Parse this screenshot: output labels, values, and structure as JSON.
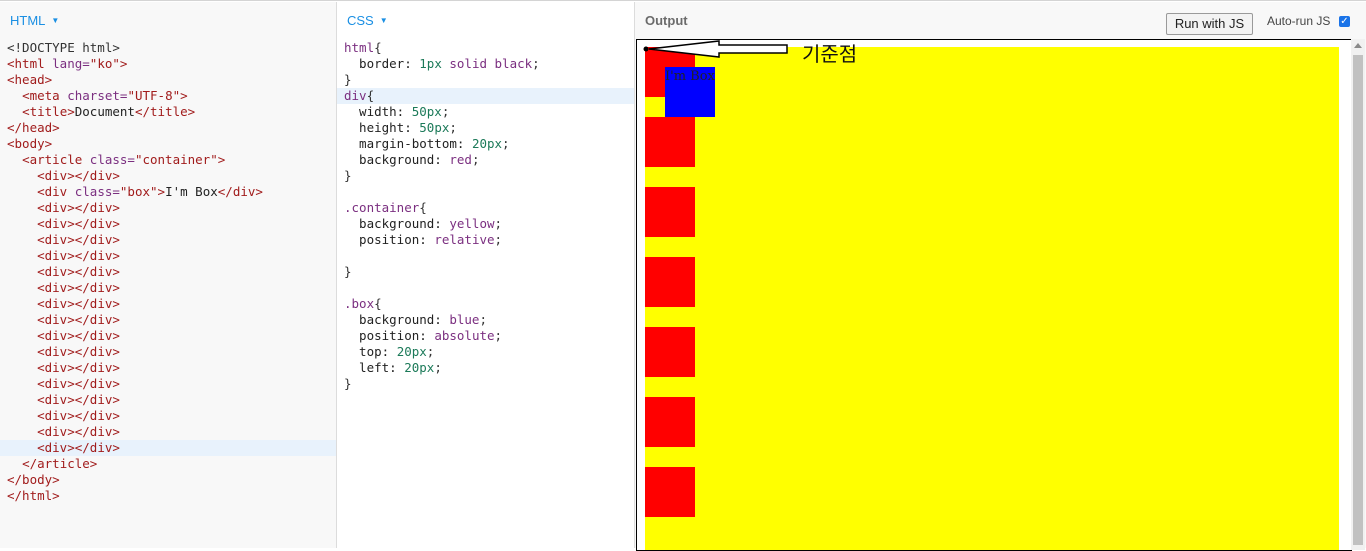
{
  "html_panel": {
    "title": "HTML",
    "lines": [
      [
        [
          "t-punc",
          "<!DOCTYPE html>"
        ]
      ],
      [
        [
          "t-tag",
          "<html "
        ],
        [
          "t-attr",
          "lang="
        ],
        [
          "t-str",
          "\"ko\""
        ],
        [
          "t-tag",
          ">"
        ]
      ],
      [
        [
          "t-tag",
          "<head>"
        ]
      ],
      [
        [
          "t-txt",
          "  "
        ],
        [
          "t-tag",
          "<meta "
        ],
        [
          "t-attr",
          "charset="
        ],
        [
          "t-str",
          "\"UTF-8\""
        ],
        [
          "t-tag",
          ">"
        ]
      ],
      [
        [
          "t-txt",
          "  "
        ],
        [
          "t-tag",
          "<title>"
        ],
        [
          "t-txt",
          "Document"
        ],
        [
          "t-tag",
          "</title>"
        ]
      ],
      [
        [
          "t-tag",
          "</head>"
        ]
      ],
      [
        [
          "t-tag",
          "<body>"
        ]
      ],
      [
        [
          "t-txt",
          "  "
        ],
        [
          "t-tag",
          "<article "
        ],
        [
          "t-attr",
          "class="
        ],
        [
          "t-str",
          "\"container\""
        ],
        [
          "t-tag",
          ">"
        ]
      ],
      [
        [
          "t-txt",
          "    "
        ],
        [
          "t-tag",
          "<div></div>"
        ]
      ],
      [
        [
          "t-txt",
          "    "
        ],
        [
          "t-tag",
          "<div "
        ],
        [
          "t-attr",
          "class="
        ],
        [
          "t-str",
          "\"box\""
        ],
        [
          "t-tag",
          ">"
        ],
        [
          "t-txt",
          "I'm Box"
        ],
        [
          "t-tag",
          "</div>"
        ]
      ],
      [
        [
          "t-txt",
          "    "
        ],
        [
          "t-tag",
          "<div></div>"
        ]
      ],
      [
        [
          "t-txt",
          "    "
        ],
        [
          "t-tag",
          "<div></div>"
        ]
      ],
      [
        [
          "t-txt",
          "    "
        ],
        [
          "t-tag",
          "<div></div>"
        ]
      ],
      [
        [
          "t-txt",
          "    "
        ],
        [
          "t-tag",
          "<div></div>"
        ]
      ],
      [
        [
          "t-txt",
          "    "
        ],
        [
          "t-tag",
          "<div></div>"
        ]
      ],
      [
        [
          "t-txt",
          "    "
        ],
        [
          "t-tag",
          "<div></div>"
        ]
      ],
      [
        [
          "t-txt",
          "    "
        ],
        [
          "t-tag",
          "<div></div>"
        ]
      ],
      [
        [
          "t-txt",
          "    "
        ],
        [
          "t-tag",
          "<div></div>"
        ]
      ],
      [
        [
          "t-txt",
          "    "
        ],
        [
          "t-tag",
          "<div></div>"
        ]
      ],
      [
        [
          "t-txt",
          "    "
        ],
        [
          "t-tag",
          "<div></div>"
        ]
      ],
      [
        [
          "t-txt",
          "    "
        ],
        [
          "t-tag",
          "<div></div>"
        ]
      ],
      [
        [
          "t-txt",
          "    "
        ],
        [
          "t-tag",
          "<div></div>"
        ]
      ],
      [
        [
          "t-txt",
          "    "
        ],
        [
          "t-tag",
          "<div></div>"
        ]
      ],
      [
        [
          "t-txt",
          "    "
        ],
        [
          "t-tag",
          "<div></div>"
        ]
      ],
      [
        [
          "t-txt",
          "    "
        ],
        [
          "t-tag",
          "<div></div>"
        ]
      ],
      [
        [
          "t-txt",
          "    "
        ],
        [
          "t-tag",
          "<div></div>"
        ]
      ],
      [
        [
          "t-txt",
          "  "
        ],
        [
          "t-tag",
          "</article>"
        ]
      ],
      [
        [
          "t-tag",
          "</body>"
        ]
      ],
      [
        [
          "t-tag",
          "</html>"
        ]
      ]
    ],
    "highlight_line": 25
  },
  "css_panel": {
    "title": "CSS",
    "lines": [
      [
        [
          "t-sel",
          "html"
        ],
        [
          "t-punc",
          "{"
        ]
      ],
      [
        [
          "t-prop",
          "  border: "
        ],
        [
          "t-num",
          "1px"
        ],
        [
          "t-val",
          " solid black"
        ],
        [
          "t-punc",
          ";"
        ]
      ],
      [
        [
          "t-punc",
          "}"
        ]
      ],
      [
        [
          "t-sel",
          "div"
        ],
        [
          "t-punc",
          "{"
        ]
      ],
      [
        [
          "t-prop",
          "  width: "
        ],
        [
          "t-num",
          "50px"
        ],
        [
          "t-punc",
          ";"
        ]
      ],
      [
        [
          "t-prop",
          "  height: "
        ],
        [
          "t-num",
          "50px"
        ],
        [
          "t-punc",
          ";"
        ]
      ],
      [
        [
          "t-prop",
          "  margin-bottom: "
        ],
        [
          "t-num",
          "20px"
        ],
        [
          "t-punc",
          ";"
        ]
      ],
      [
        [
          "t-prop",
          "  background: "
        ],
        [
          "t-val",
          "red"
        ],
        [
          "t-punc",
          ";"
        ]
      ],
      [
        [
          "t-punc",
          "}"
        ]
      ],
      [
        [
          "t-txt",
          ""
        ]
      ],
      [
        [
          "t-sel",
          ".container"
        ],
        [
          "t-punc",
          "{"
        ]
      ],
      [
        [
          "t-prop",
          "  background: "
        ],
        [
          "t-val",
          "yellow"
        ],
        [
          "t-punc",
          ";"
        ]
      ],
      [
        [
          "t-prop",
          "  position: "
        ],
        [
          "t-val",
          "relative"
        ],
        [
          "t-punc",
          ";"
        ]
      ],
      [
        [
          "t-txt",
          ""
        ]
      ],
      [
        [
          "t-punc",
          "}"
        ]
      ],
      [
        [
          "t-txt",
          ""
        ]
      ],
      [
        [
          "t-sel",
          ".box"
        ],
        [
          "t-punc",
          "{"
        ]
      ],
      [
        [
          "t-prop",
          "  background: "
        ],
        [
          "t-val",
          "blue"
        ],
        [
          "t-punc",
          ";"
        ]
      ],
      [
        [
          "t-prop",
          "  position: "
        ],
        [
          "t-val",
          "absolute"
        ],
        [
          "t-punc",
          ";"
        ]
      ],
      [
        [
          "t-prop",
          "  top: "
        ],
        [
          "t-num",
          "20px"
        ],
        [
          "t-punc",
          ";"
        ]
      ],
      [
        [
          "t-prop",
          "  left: "
        ],
        [
          "t-num",
          "20px"
        ],
        [
          "t-punc",
          ";"
        ]
      ],
      [
        [
          "t-punc",
          "}"
        ]
      ]
    ],
    "highlight_line": 3
  },
  "output_panel": {
    "title": "Output",
    "run_button": "Run with JS",
    "autorun_label": "Auto-run JS",
    "autorun_checked": true,
    "box_text": "I'm Box",
    "red_box_count": 7,
    "annotation": "기준점",
    "colors": {
      "container": "#ffff00",
      "red": "#ff0000",
      "blue": "#0000ff"
    }
  }
}
